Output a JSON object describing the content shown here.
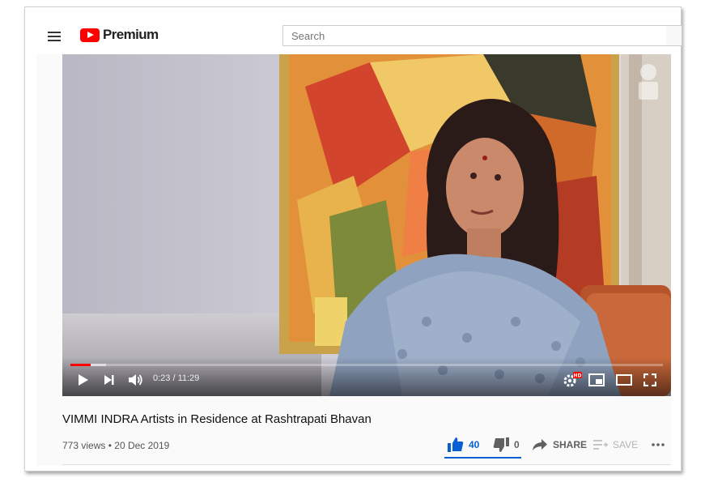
{
  "header": {
    "brand_label": "Premium",
    "search_placeholder": "Search",
    "icons": [
      "menu-icon",
      "youtube-logo-icon"
    ]
  },
  "player": {
    "time_display": "0:23 / 11:29",
    "progress_fraction": 0.033,
    "controls": [
      "play-icon",
      "next-icon",
      "volume-icon",
      "settings-hd-icon",
      "miniplayer-icon",
      "theater-icon",
      "fullscreen-icon"
    ],
    "settings_badge": "HD",
    "progress_color": "#ff0000"
  },
  "video": {
    "title": "VIMMI INDRA Artists in Residence at Rashtrapati Bhavan",
    "views": "773 views",
    "separator": "•",
    "date": "20 Dec 2019"
  },
  "actions": {
    "likes": "40",
    "dislikes": "0",
    "share_label": "SHARE",
    "save_label": "SAVE",
    "like_color": "#065fd4"
  }
}
